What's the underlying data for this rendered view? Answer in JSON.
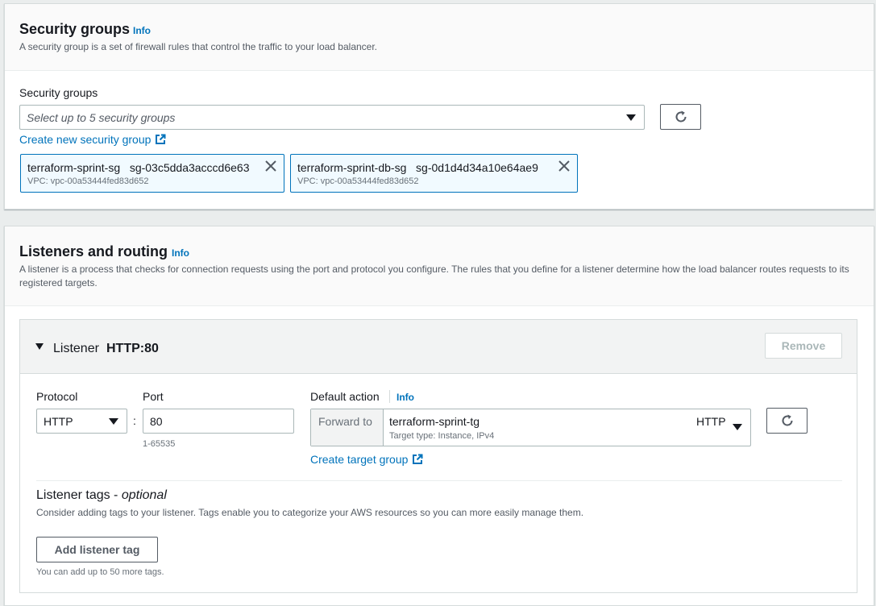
{
  "security_groups": {
    "title": "Security groups",
    "info_label": "Info",
    "description": "A security group is a set of firewall rules that control the traffic to your load balancer.",
    "field_label": "Security groups",
    "select_placeholder": "Select up to 5 security groups",
    "create_link": "Create new security group",
    "tokens": [
      {
        "name": "terraform-sprint-sg",
        "id": "sg-03c5dda3acccd6e63",
        "vpc": "VPC: vpc-00a53444fed83d652"
      },
      {
        "name": "terraform-sprint-db-sg",
        "id": "sg-0d1d4d34a10e64ae9",
        "vpc": "VPC: vpc-00a53444fed83d652"
      }
    ]
  },
  "listeners": {
    "title": "Listeners and routing",
    "info_label": "Info",
    "description": "A listener is a process that checks for connection requests using the port and protocol you configure. The rules that you define for a listener determine how the load balancer routes requests to its registered targets.",
    "listener": {
      "label": "Listener",
      "name": "HTTP:80",
      "remove_label": "Remove",
      "protocol_label": "Protocol",
      "protocol_value": "HTTP",
      "separator": ":",
      "port_label": "Port",
      "port_value": "80",
      "port_hint": "1-65535",
      "default_action_label": "Default action",
      "default_action_info": "Info",
      "forward_to_label": "Forward to",
      "target_group_name": "terraform-sprint-tg",
      "target_group_meta": "Target type: Instance, IPv4",
      "target_group_protocol": "HTTP",
      "create_target_group_link": "Create target group",
      "tags_title": "Listener tags",
      "tags_optional": "optional",
      "tags_dash": " - ",
      "tags_description": "Consider adding tags to your listener. Tags enable you to categorize your AWS resources so you can more easily manage them.",
      "add_tag_label": "Add listener tag",
      "tags_hint": "You can add up to 50 more tags."
    }
  },
  "colors": {
    "accent": "#0073bb",
    "token_bg": "#f1faff",
    "page_bg": "#eaeded"
  }
}
